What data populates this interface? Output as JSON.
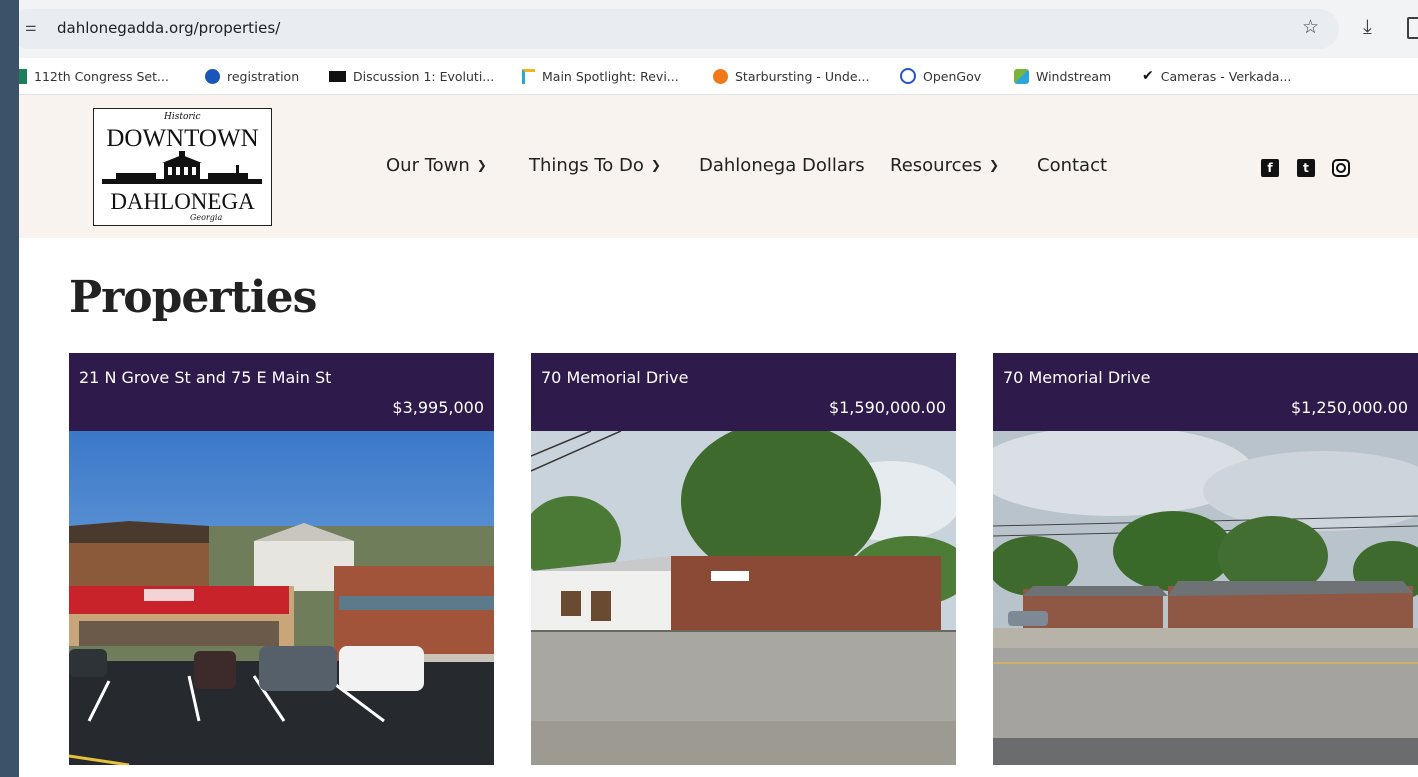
{
  "browser": {
    "url": "dahlonegadda.org/properties/",
    "icons": [
      "site-info-icon",
      "star-icon",
      "download-icon",
      "side-panel-icon"
    ]
  },
  "bookmarks": [
    {
      "label": "112th Congress Set...",
      "icon": "congress-icon",
      "color": "#1a7f5a"
    },
    {
      "label": "registration",
      "icon": "registration-icon",
      "color": "#1a56b8"
    },
    {
      "label": "Discussion 1: Evoluti...",
      "icon": "d2l-icon",
      "color": "#111111"
    },
    {
      "label": "Main Spotlight: Revi...",
      "icon": "spotlight-icon",
      "color": "#2aa7d8"
    },
    {
      "label": "Starbursting - Unde...",
      "icon": "starbursting-icon",
      "color": "#f07a1a"
    },
    {
      "label": "OpenGov",
      "icon": "opengov-icon",
      "color": "#2456c8"
    },
    {
      "label": "Windstream",
      "icon": "windstream-icon",
      "color": "#7bb33a"
    },
    {
      "label": "Cameras - Verkada...",
      "icon": "verkada-icon",
      "color": "#111111"
    }
  ],
  "site": {
    "logo": {
      "top_script": "Historic",
      "line1": "DOWNTOWN",
      "line2": "DAHLONEGA",
      "bottom_script": "Georgia"
    },
    "nav": [
      {
        "label": "Our Town",
        "dropdown": true
      },
      {
        "label": "Things To Do",
        "dropdown": true
      },
      {
        "label": "Dahlonega Dollars",
        "dropdown": false
      },
      {
        "label": "Resources",
        "dropdown": true
      },
      {
        "label": "Contact",
        "dropdown": false
      }
    ],
    "social": [
      "facebook-icon",
      "twitter-icon",
      "instagram-icon"
    ]
  },
  "page": {
    "title": "Properties",
    "cards": [
      {
        "address": "21 N Grove St and 75 E Main St",
        "price": "$3,995,000"
      },
      {
        "address": "70 Memorial Drive",
        "price": "$1,590,000.00"
      },
      {
        "address": "70 Memorial Drive",
        "price": "$1,250,000.00"
      }
    ]
  },
  "colors": {
    "card_band": "#2f1b4b",
    "header_bg": "#f8f3ee",
    "outer_bg": "#3b5268"
  }
}
